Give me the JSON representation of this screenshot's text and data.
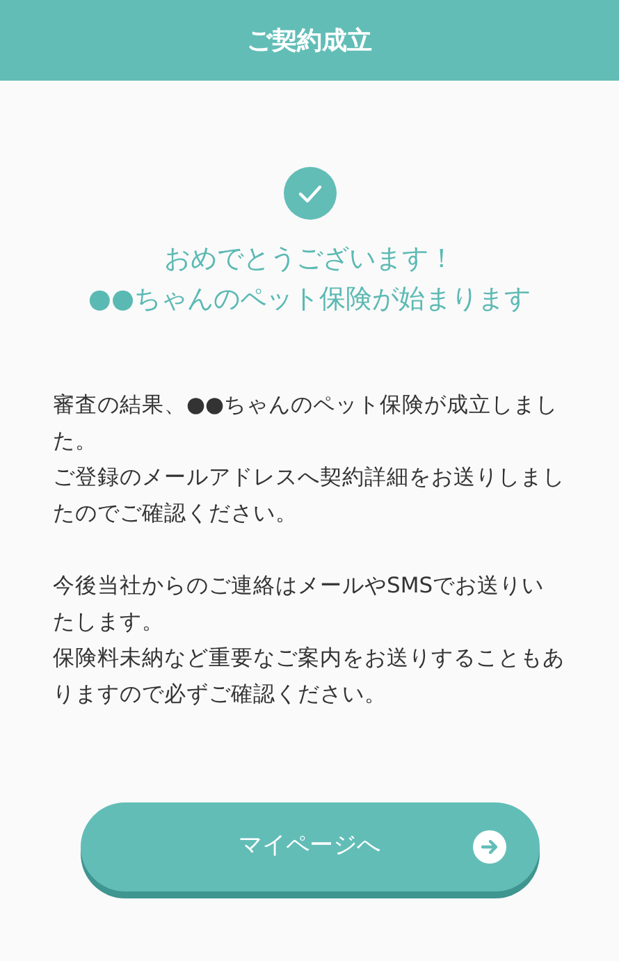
{
  "header": {
    "title": "ご契約成立"
  },
  "headline": [
    "おめでとうございます！",
    "●●ちゃんのペット保険が始まります"
  ],
  "paragraph_groups": [
    [
      "審査の結果、●●ちゃんのペット保険が成立しました。",
      "ご登録のメールアドレスへ契約詳細をお送りしましたのでご確認ください。"
    ],
    [
      "今後当社からのご連絡はメールやSMSでお送りいたします。",
      "保険料未納など重要なご案内をお送りすることもありますので必ずご確認ください。"
    ]
  ],
  "button": {
    "label": "マイページへ"
  }
}
